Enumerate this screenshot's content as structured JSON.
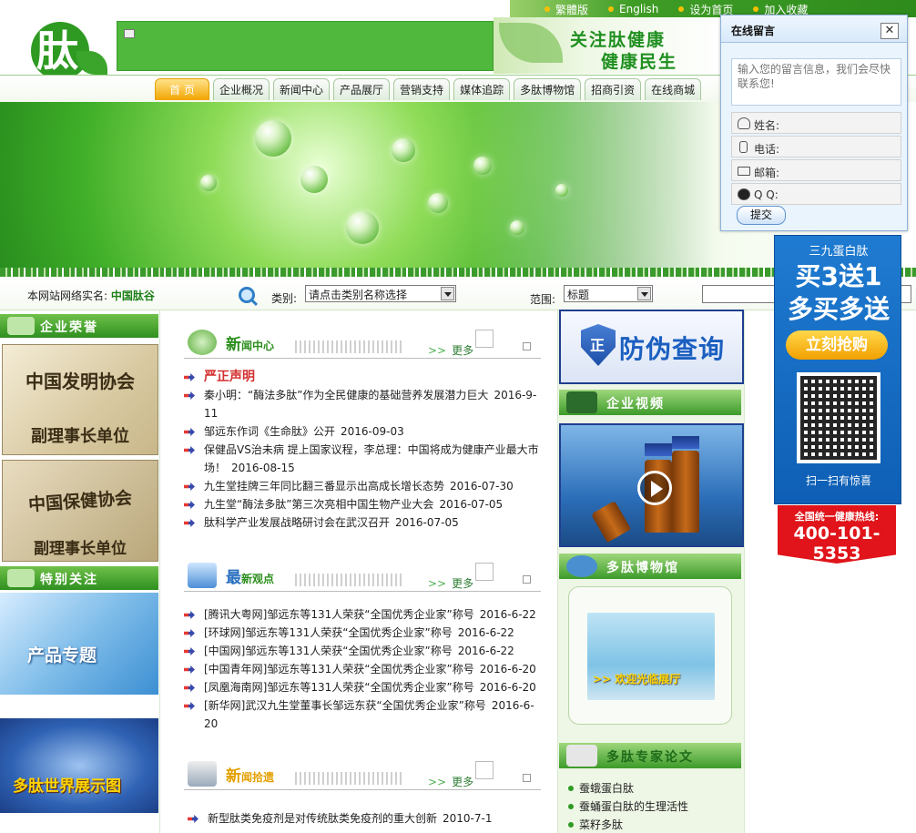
{
  "toplinks": [
    "繁體版",
    "English",
    "设为首页",
    "加入收藏"
  ],
  "logo_char": "肽",
  "slogan": [
    "关注肽健康",
    "健康民生"
  ],
  "nav": [
    "首 页",
    "企业概况",
    "新闻中心",
    "产品展厅",
    "营销支持",
    "媒体追踪",
    "多肽博物馆",
    "招商引资",
    "在线商城"
  ],
  "search": {
    "label_prefix": "本网站网络实名:",
    "label_name": "中国肽谷",
    "category_label": "类别:",
    "category_value": "请点击类别名称选择",
    "scope_label": "范围:",
    "scope_value": "标题"
  },
  "left": {
    "honor_title": "企业荣誉",
    "plaque1": {
      "top": "中国发明协会",
      "bottom": "副理事长单位"
    },
    "plaque2": {
      "top": "中国保健协会",
      "bottom": "副理事长单位"
    },
    "focus_title": "特别关注",
    "product_topic": "产品专题",
    "world_map": "多肽世界展示图"
  },
  "news_center": {
    "title_big": "新",
    "title_rest": "闻中心",
    "more": "更多",
    "items": [
      {
        "text": "严正声明",
        "date": "",
        "hot": true
      },
      {
        "text": "秦小明：“酶法多肽”作为全民健康的基础营养发展潜力巨大",
        "date": "2016-9-11"
      },
      {
        "text": "邹远东作词《生命肽》公开",
        "date": "2016-09-03"
      },
      {
        "text": "保健品VS治未病 提上国家议程，李总理：中国将成为健康产业最大市场！",
        "date": "2016-08-15"
      },
      {
        "text": "九生堂挂牌三年同比翻三番显示出高成长增长态势",
        "date": "2016-07-30"
      },
      {
        "text": "九生堂“酶法多肽”第三次亮相中国生物产业大会",
        "date": "2016-07-05"
      },
      {
        "text": "肽科学产业发展战略研讨会在武汉召开",
        "date": "2016-07-05"
      }
    ]
  },
  "latest_views": {
    "title_big": "最",
    "title_rest": "新观点",
    "more": "更多",
    "items": [
      {
        "text": "[腾讯大粤网]邹远东等131人荣获“全国优秀企业家”称号",
        "date": "2016-6-22"
      },
      {
        "text": "[环球网]邹远东等131人荣获“全国优秀企业家”称号",
        "date": "2016-6-22"
      },
      {
        "text": "[中国网]邹远东等131人荣获“全国优秀企业家”称号",
        "date": "2016-6-22"
      },
      {
        "text": "[中国青年网]邹远东等131人荣获“全国优秀企业家”称号",
        "date": "2016-6-20"
      },
      {
        "text": "[凤凰海南网]邹远东等131人荣获“全国优秀企业家”称号",
        "date": "2016-6-20"
      },
      {
        "text": "[新华网]武汉九生堂董事长邹远东获“全国优秀企业家”称号",
        "date": "2016-6-20"
      }
    ]
  },
  "news_pick": {
    "title_big": "新",
    "title_rest": "闻拾遗",
    "more": "更多",
    "items": [
      {
        "text": "新型肽类免疫剂是对传统肽类免疫剂的重大创新",
        "date": "2010-7-1"
      }
    ]
  },
  "right_mid": {
    "anti_fake": "防伪查询",
    "anti_fake_badge": "正",
    "video_title": "企业视频",
    "museum_title": "多肽博物馆",
    "museum_caption": "欢迎光临展厅",
    "papers_title": "多肽专家论文",
    "papers": [
      "蚕蛾蛋白肽",
      "蚕蛹蛋白肽的生理活性",
      "菜籽多肽"
    ]
  },
  "message": {
    "title": "在线留言",
    "close": "✕",
    "placeholder": "输入您的留言信息，我们会尽快联系您!",
    "fields": [
      "姓名:",
      "电话:",
      "邮箱:",
      "Q  Q:"
    ],
    "submit": "提交"
  },
  "promo": {
    "top": "三九蛋白肽",
    "line1": "买3送1",
    "line2": "多买多送",
    "buy": "立刻抢购",
    "scan": "扫一扫有惊喜",
    "hotline_label": "全国统一健康热线:",
    "hotline": "400-101-5353"
  }
}
